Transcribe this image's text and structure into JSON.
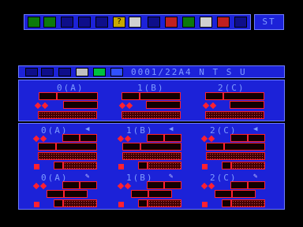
{
  "toolbar": {
    "icons": [
      "list-icon",
      "lines-icon",
      "slash-icon",
      "down-arrow-icon",
      "up-arrow-icon",
      "help-icon",
      "tape-icon",
      "disk-icon",
      "book-icon",
      "grid-icon",
      "checker-icon",
      "close-icon",
      "monitor-icon"
    ]
  },
  "status": {
    "st_label": "ST"
  },
  "bar2": {
    "file_label": "0001/22A4  N T S U",
    "icons": [
      "pen-icon",
      "window-icon",
      "scatter-icon",
      "checker-icon",
      "green-box-icon",
      "blue-box-icon"
    ]
  },
  "drive_panel": {
    "labels": [
      "0(A)",
      "1(B)",
      "2(C)"
    ]
  },
  "lower_panel": {
    "row1_labels": [
      "0(A)",
      "1(B)",
      "2(C)"
    ],
    "row2_labels": [
      "0(A)",
      "1(B)",
      "2(C)"
    ]
  },
  "colors": {
    "bg": "#000000",
    "panel": "#1c22d8",
    "text": "#7f9cff",
    "red": "#ff2030"
  }
}
